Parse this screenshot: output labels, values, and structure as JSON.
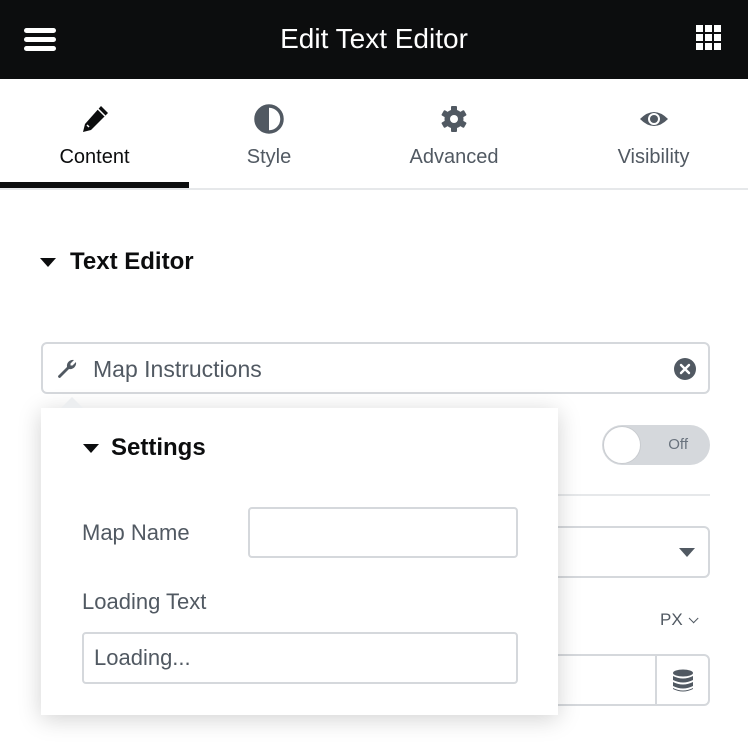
{
  "header": {
    "title": "Edit Text Editor",
    "menu_icon": "hamburger-icon",
    "apps_icon": "grid-icon"
  },
  "tabs": [
    {
      "label": "Content",
      "icon": "pencil-icon",
      "active": true
    },
    {
      "label": "Style",
      "icon": "half-circle-icon",
      "active": false
    },
    {
      "label": "Advanced",
      "icon": "gear-icon",
      "active": false
    },
    {
      "label": "Visibility",
      "icon": "eye-icon",
      "active": false
    }
  ],
  "section": {
    "title": "Text Editor"
  },
  "instructions_field": {
    "value": "Map Instructions",
    "icon": "wrench-icon",
    "clear_icon": "close-circle-icon"
  },
  "toggle": {
    "label": "Off",
    "state": false
  },
  "unit_selector": {
    "value": "PX"
  },
  "popover": {
    "title": "Settings",
    "map_name": {
      "label": "Map Name",
      "value": ""
    },
    "loading_text": {
      "label": "Loading Text",
      "value": "Loading..."
    }
  },
  "colors": {
    "header_bg": "#0c0d0e",
    "text_primary": "#0c0d0e",
    "text_secondary": "#515962",
    "border": "#d5d8dc"
  }
}
